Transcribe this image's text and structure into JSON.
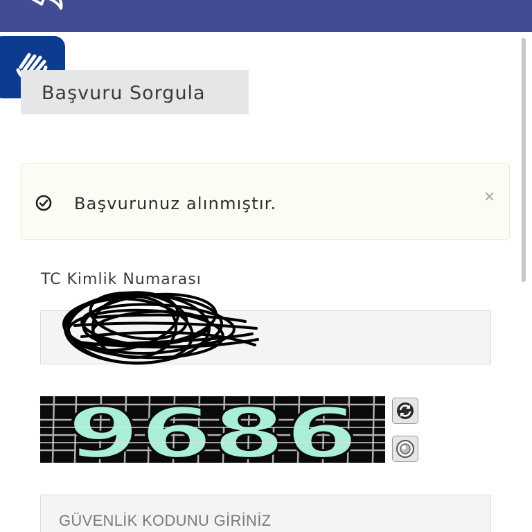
{
  "header": {
    "back_icon": "back-arrow-icon",
    "background": "#434b94"
  },
  "accessibility": {
    "icon": "hand-accessibility-icon",
    "background": "#0d3b8f"
  },
  "section": {
    "title": "Başvuru Sorgula"
  },
  "alert": {
    "message": "Başvurunuz alınmıştır.",
    "icon": "check-circle-icon",
    "close_label": "×"
  },
  "form": {
    "tc_label": "TC Kimlik Numarası",
    "tc_value": "",
    "captcha_code": "9686",
    "captcha_refresh_icon": "refresh-icon",
    "captcha_audio_icon": "speaker-icon",
    "security_code_placeholder": "GÜVENLİK KODUNU GİRİNİZ"
  }
}
